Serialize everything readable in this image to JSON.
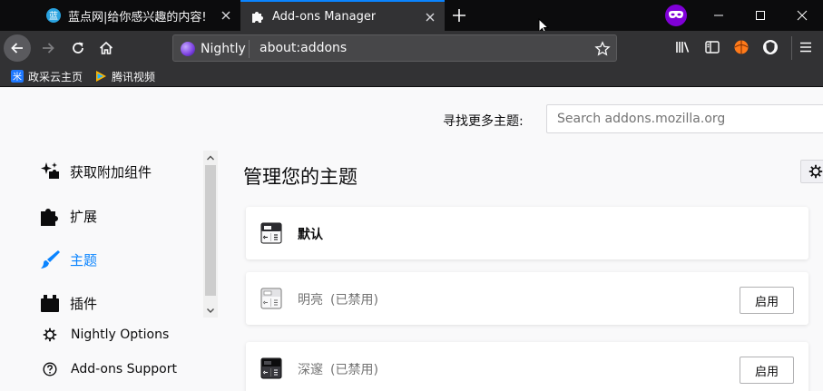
{
  "tabs": [
    {
      "title": "蓝点网|给你感兴趣的内容!",
      "active": false
    },
    {
      "title": "Add-ons Manager",
      "active": true
    }
  ],
  "urlbar": {
    "identity_label": "Nightly",
    "url": "about:addons"
  },
  "bookmarks": [
    {
      "label": "政采云主页"
    },
    {
      "label": "腾讯视频"
    }
  ],
  "search": {
    "label": "寻找更多主题:",
    "placeholder": "Search addons.mozilla.org"
  },
  "sidebar": {
    "categories": [
      {
        "label": "获取附加组件",
        "selected": false
      },
      {
        "label": "扩展",
        "selected": false
      },
      {
        "label": "主题",
        "selected": true
      },
      {
        "label": "插件",
        "selected": false
      }
    ],
    "footer": [
      {
        "label": "Nightly Options"
      },
      {
        "label": "Add-ons Support"
      }
    ]
  },
  "main": {
    "heading": "管理您的主题",
    "themes": [
      {
        "name": "默认",
        "status": "",
        "enabled": true,
        "button": ""
      },
      {
        "name": "明亮",
        "status": "(已禁用)",
        "enabled": false,
        "button": "启用"
      },
      {
        "name": "深邃",
        "status": "(已禁用)",
        "enabled": false,
        "button": "启用"
      }
    ]
  },
  "colors": {
    "accent": "#0a84ff",
    "tabbar": "#0c0c0d",
    "toolbar": "#323234",
    "private": "#8000d7"
  }
}
